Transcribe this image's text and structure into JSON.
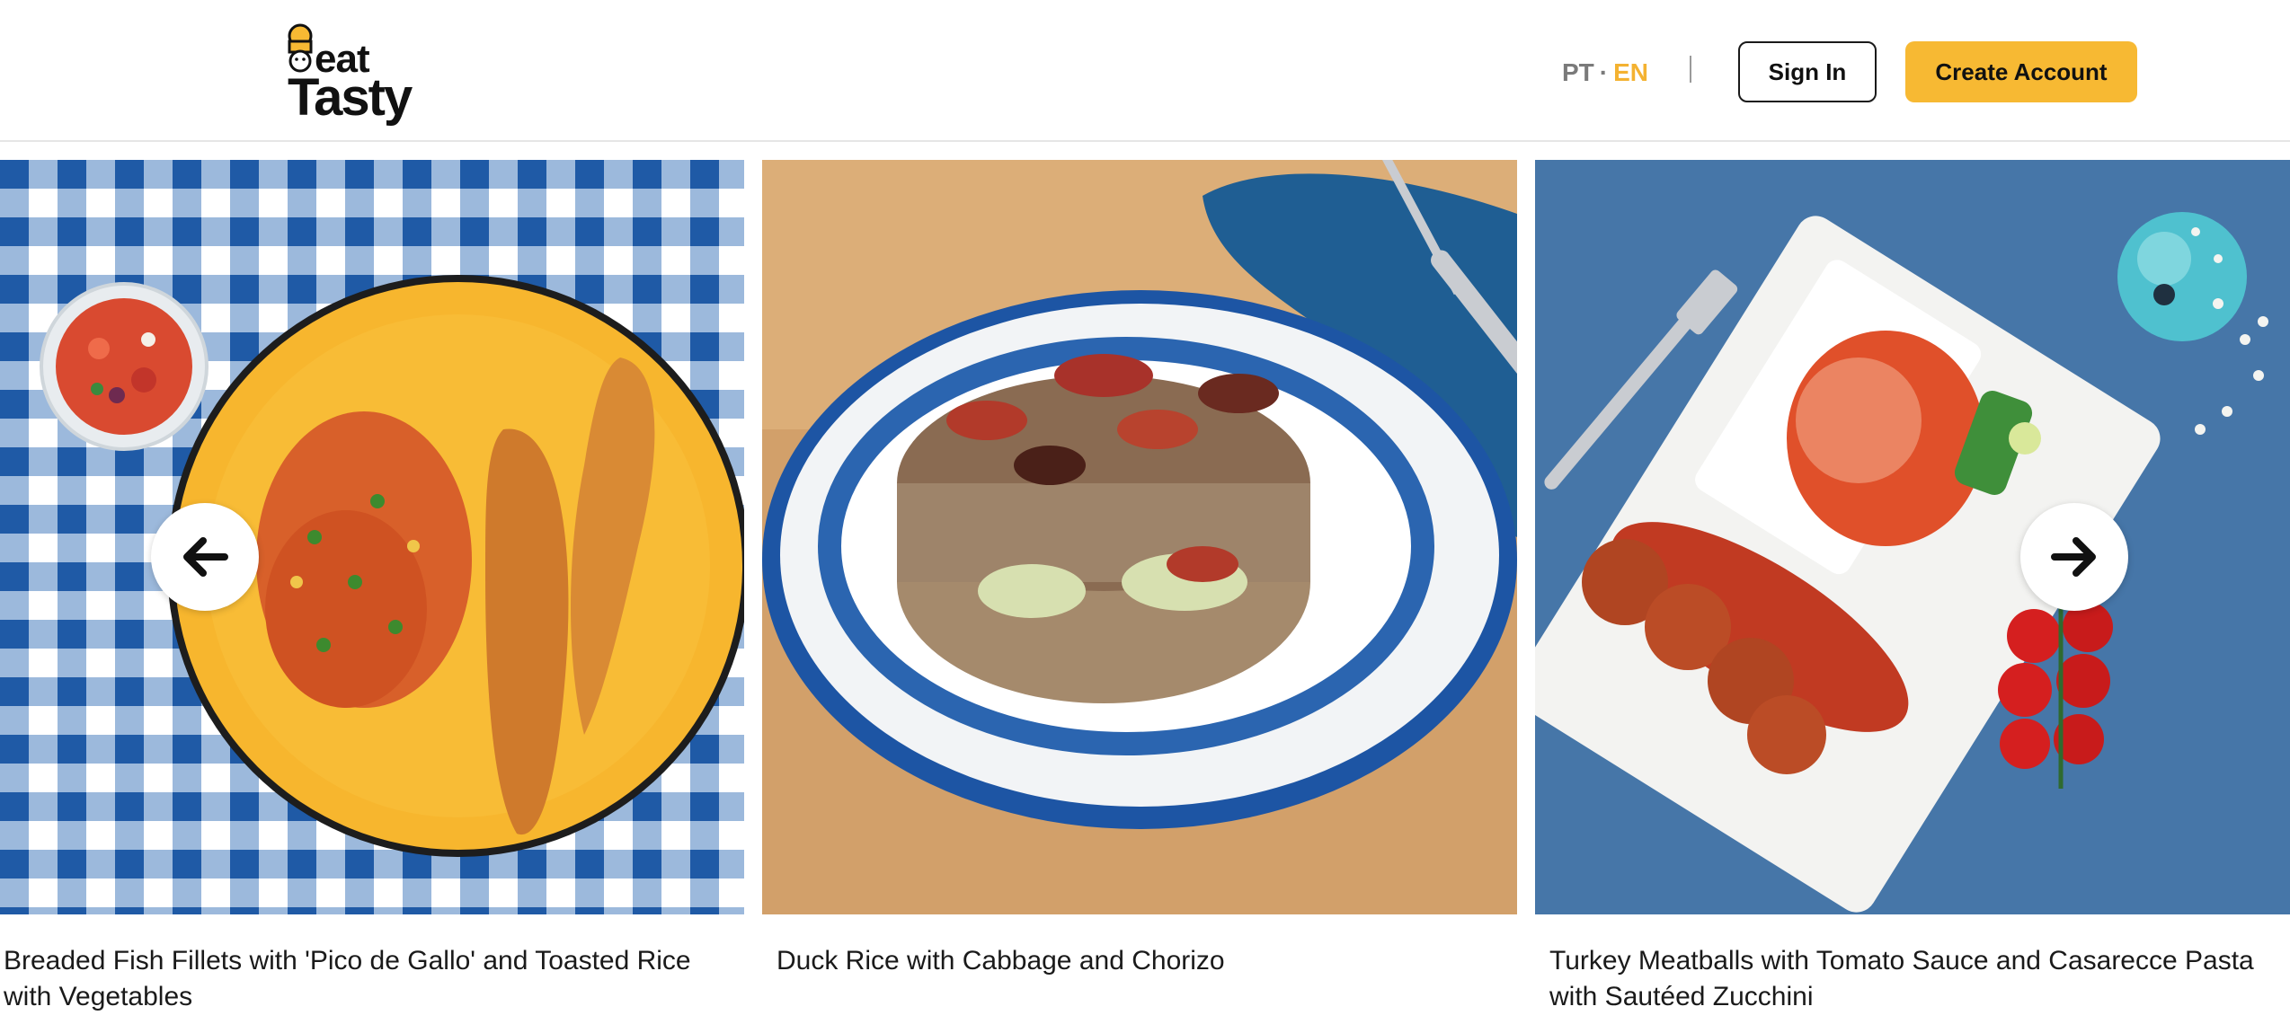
{
  "header": {
    "logo_eat": "eat",
    "logo_tasty": "Tasty",
    "lang_pt": "PT",
    "lang_separator": "·",
    "lang_en": "EN",
    "sign_in_label": "Sign In",
    "create_account_label": "Create Account"
  },
  "colors": {
    "accent": "#f7b933",
    "lang_active": "#f4b231",
    "lang_inactive": "#7a7a7a"
  },
  "carousel": {
    "prev_icon": "arrow-left-icon",
    "next_icon": "arrow-right-icon",
    "items": [
      {
        "title": "Breaded Fish Fillets with 'Pico de Gallo' and Toasted Rice with Vegetables"
      },
      {
        "title": "Duck Rice with Cabbage and Chorizo"
      },
      {
        "title": "Turkey Meatballs with Tomato Sauce and Casarecce Pasta with Sautéed Zucchini"
      }
    ]
  }
}
